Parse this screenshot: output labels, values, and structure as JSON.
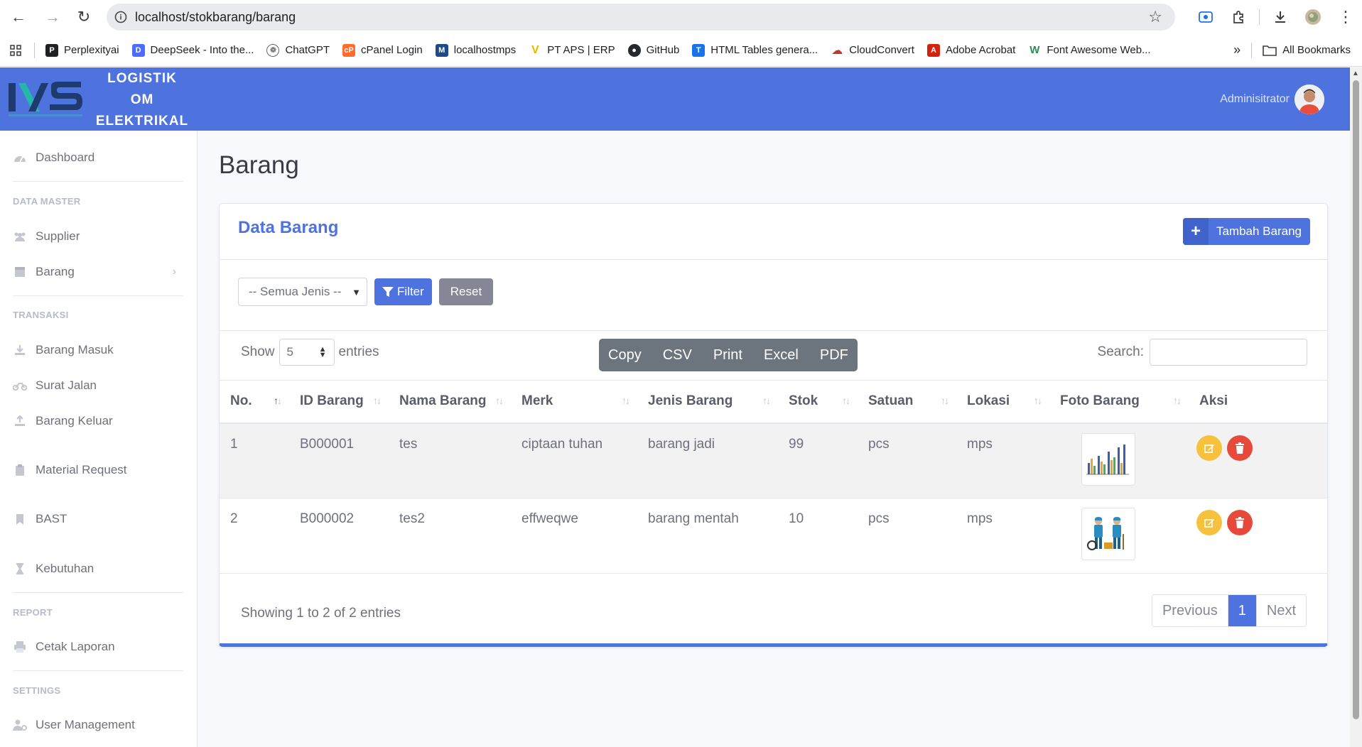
{
  "browser": {
    "url": "localhost/stokbarang/barang",
    "bookmarks": [
      {
        "label": "Perplexityai",
        "color": "#202124",
        "glyph": "P"
      },
      {
        "label": "DeepSeek - Into the...",
        "color": "#4d6bfe",
        "glyph": "D"
      },
      {
        "label": "ChatGPT",
        "color": "#444444",
        "glyph": "G"
      },
      {
        "label": "cPanel Login",
        "color": "#ff6c2c",
        "glyph": "c"
      },
      {
        "label": "localhostmps",
        "color": "#1e4a8c",
        "glyph": "M"
      },
      {
        "label": "PT APS | ERP",
        "color": "#e8b800",
        "glyph": "V"
      },
      {
        "label": "GitHub",
        "color": "#24292e",
        "glyph": "G"
      },
      {
        "label": "HTML Tables genera...",
        "color": "#1a73e8",
        "glyph": "T"
      },
      {
        "label": "CloudConvert",
        "color": "#c0392b",
        "glyph": "C"
      },
      {
        "label": "Adobe Acrobat",
        "color": "#d4220f",
        "glyph": "A"
      },
      {
        "label": "Font Awesome Web...",
        "color": "#2e8b57",
        "glyph": "W"
      }
    ],
    "all_bookmarks": "All Bookmarks"
  },
  "topbar": {
    "brand_lines": [
      "LOGISTIK",
      "OM",
      "ELEKTRIKAL"
    ],
    "user_name": "Adminisitrator"
  },
  "sidebar": {
    "dashboard": "Dashboard",
    "heading_master": "DATA MASTER",
    "supplier": "Supplier",
    "barang": "Barang",
    "heading_transaksi": "TRANSAKSI",
    "barang_masuk": "Barang Masuk",
    "surat_jalan": "Surat Jalan",
    "barang_keluar": "Barang Keluar",
    "material_request": "Material Request",
    "bast": "BAST",
    "kebutuhan": "Kebutuhan",
    "heading_report": "REPORT",
    "cetak_laporan": "Cetak Laporan",
    "heading_settings": "SETTINGS",
    "user_management": "User Management"
  },
  "page": {
    "title": "Barang",
    "card_title": "Data Barang",
    "add_button": "Tambah Barang",
    "filter_select": "-- Semua Jenis --",
    "filter_button": "Filter",
    "reset_button": "Reset",
    "show_label": "Show",
    "entries_value": "5",
    "entries_label": "entries",
    "export_buttons": [
      "Copy",
      "CSV",
      "Print",
      "Excel",
      "PDF"
    ],
    "search_label": "Search:",
    "info": "Showing 1 to 2 of 2 entries",
    "pager": {
      "previous": "Previous",
      "current": "1",
      "next": "Next"
    }
  },
  "table": {
    "headers": [
      "No.",
      "ID Barang",
      "Nama Barang",
      "Merk",
      "Jenis Barang",
      "Stok",
      "Satuan",
      "Lokasi",
      "Foto Barang",
      "Aksi"
    ],
    "rows": [
      {
        "no": "1",
        "id": "B000001",
        "nama": "tes",
        "merk": "ciptaan tuhan",
        "jenis": "barang jadi",
        "stok": "99",
        "satuan": "pcs",
        "lokasi": "mps",
        "foto": "bar-chart-photo"
      },
      {
        "no": "2",
        "id": "B000002",
        "nama": "tes2",
        "merk": "effweqwe",
        "jenis": "barang mentah",
        "stok": "10",
        "satuan": "pcs",
        "lokasi": "mps",
        "foto": "workers-photo"
      }
    ]
  },
  "colors": {
    "primary": "#4e73df",
    "warning": "#f6c23e",
    "danger": "#e74a3b",
    "secondary": "#858796"
  }
}
